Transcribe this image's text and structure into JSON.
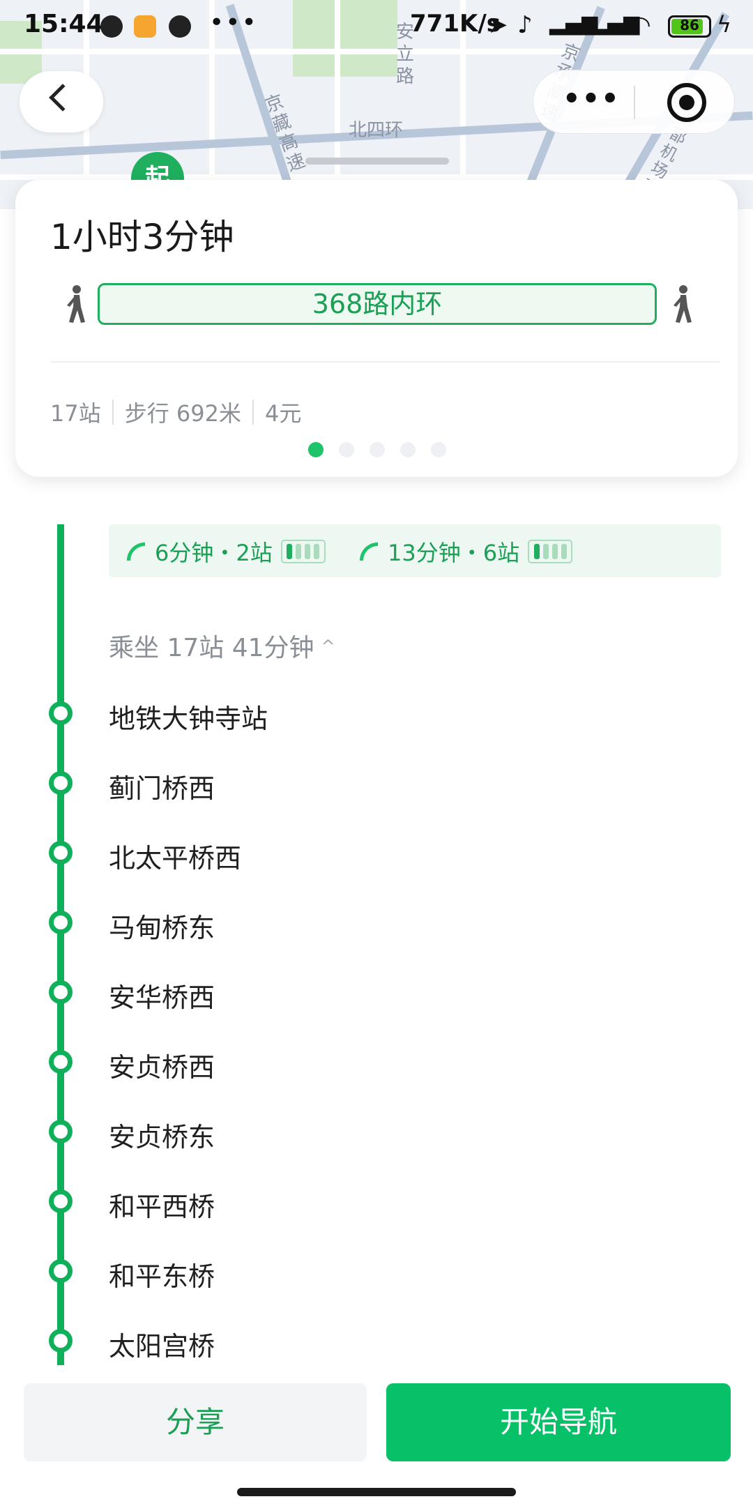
{
  "status_bar": {
    "time": "15:44",
    "net_speed": "771K/s",
    "battery_level": "86",
    "battery_fraction": 0.86
  },
  "map": {
    "labels": [
      "安立路",
      "京藏高速",
      "北四环",
      "京承高速",
      "首都机场高速"
    ],
    "start_marker": "起"
  },
  "summary": {
    "duration": "1小时3分钟",
    "route_name": "368路内环",
    "stats": [
      "17站",
      "步行 692米",
      "4元"
    ],
    "pages": 5,
    "active_page": 1
  },
  "crowding": [
    {
      "text": "6分钟・2站",
      "level": 1,
      "capacity": 4
    },
    {
      "text": "13分钟・6站",
      "level": 1,
      "capacity": 4
    }
  ],
  "ride_summary": "乘坐 17站 41分钟",
  "stops": [
    "地铁大钟寺站",
    "蓟门桥西",
    "北太平桥西",
    "马甸桥东",
    "安华桥西",
    "安贞桥西",
    "安贞桥东",
    "和平西桥",
    "和平东桥",
    "太阳宫桥"
  ],
  "actions": {
    "share": "分享",
    "start_navigation": "开始导航"
  },
  "colors": {
    "accent": "#06c167",
    "route_line": "#10b05a",
    "text_secondary": "#8a8f96"
  }
}
